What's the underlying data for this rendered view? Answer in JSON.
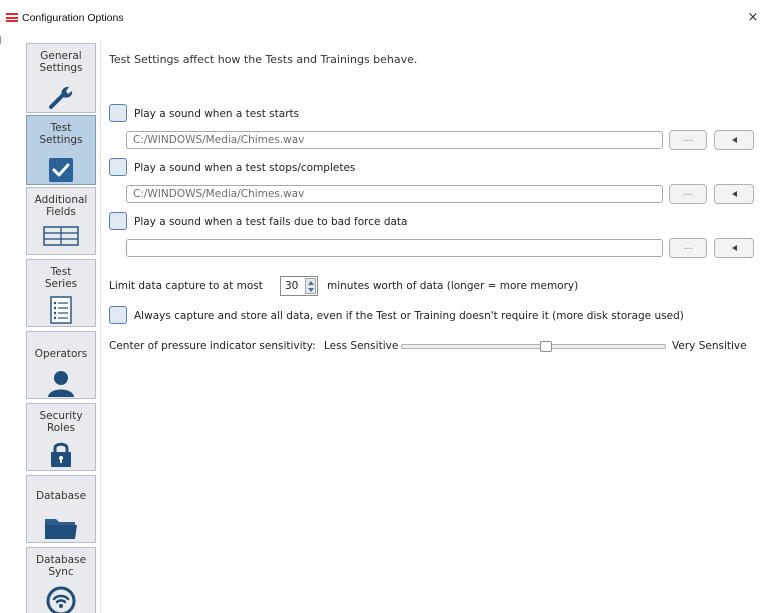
{
  "window": {
    "title": "Configuration Options",
    "close_glyph": "×",
    "app_icon": "menu-lines-icon"
  },
  "sidebar": {
    "items": [
      {
        "label": "General\nSettings",
        "icon": "wrench-icon",
        "active": false
      },
      {
        "label": "Test\nSettings",
        "icon": "checkmark-icon",
        "active": true
      },
      {
        "label": "Additional\nFields",
        "icon": "table-icon",
        "active": false
      },
      {
        "label": "Test\nSeries",
        "icon": "list-icon",
        "active": false
      },
      {
        "label": "Operators",
        "icon": "person-icon",
        "active": false
      },
      {
        "label": "Security\nRoles",
        "icon": "lock-icon",
        "active": false
      },
      {
        "label": "Database",
        "icon": "folder-icon",
        "active": false
      },
      {
        "label": "Database\nSync",
        "icon": "wifi-sync-icon",
        "active": false
      }
    ]
  },
  "content": {
    "intro": "Test Settings affect how the Tests and Trainings behave.",
    "sounds": [
      {
        "label": "Play a sound when a test starts",
        "checked": false,
        "path": "C:/WINDOWS/Media/Chimes.wav"
      },
      {
        "label": "Play a sound when a test stops/completes",
        "checked": false,
        "path": "C:/WINDOWS/Media/Chimes.wav"
      },
      {
        "label": "Play a sound when a test fails due to bad force data",
        "checked": false,
        "path": ""
      }
    ],
    "browse_label": "...",
    "limit": {
      "prefix": "Limit data capture to at most",
      "value": "30",
      "suffix": "minutes worth of data (longer = more memory)"
    },
    "always_capture": {
      "label": "Always capture and store all data, even if the Test or Training doesn't require it (more disk storage used)",
      "checked": false
    },
    "sensitivity": {
      "prefix": "Center of pressure indicator sensitivity:",
      "less": "Less Sensitive",
      "more": "Very Sensitive",
      "level": 0.55
    }
  },
  "colors": {
    "accent_red": "#e0282e",
    "active_tab": "#b8cfe4",
    "icon_blue": "#1f4e7a",
    "checkbox_border": "#5a7fb0"
  }
}
